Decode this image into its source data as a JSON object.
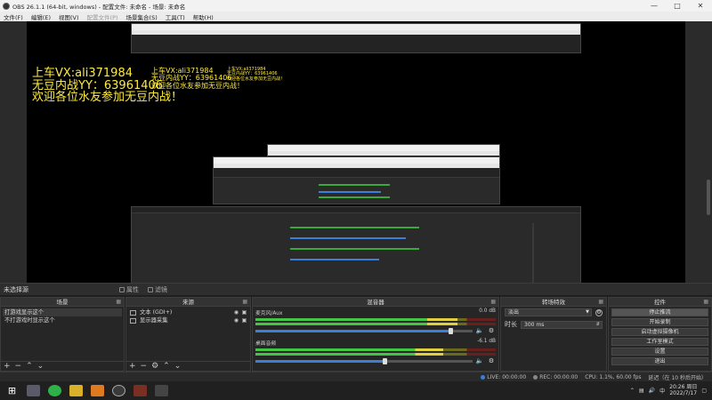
{
  "window": {
    "title": "OBS 26.1.1 (64-bit, windows) - 配置文件: 未命名 - 场景: 未命名"
  },
  "menu": {
    "items": [
      {
        "label": "文件(F)",
        "disabled": false
      },
      {
        "label": "编辑(E)",
        "disabled": false
      },
      {
        "label": "视图(V)",
        "disabled": false
      },
      {
        "label": "配置文件(P)",
        "disabled": true
      },
      {
        "label": "场景集合(S)",
        "disabled": false
      },
      {
        "label": "工具(T)",
        "disabled": false
      },
      {
        "label": "帮助(H)",
        "disabled": false
      }
    ]
  },
  "overlay": {
    "line1": "上车VX:ali371984",
    "line2": "无豆内战YY：63961406",
    "line3": "欢迎各位水友参加无豆内战！"
  },
  "tabline": {
    "no_source": "未选择源",
    "properties": "属性",
    "filters": "滤镜"
  },
  "scenes": {
    "title": "场景",
    "items": [
      "打游戏显示这个",
      "不打游戏时显示这个"
    ]
  },
  "sources": {
    "title": "来源",
    "items": [
      "文本 (GDI+)",
      "显示器采集"
    ]
  },
  "mixer": {
    "title": "混音器",
    "channels": [
      {
        "name": "麦克风/Aux",
        "db": "0.0 dB",
        "level": 0.84,
        "volume": 0.9
      },
      {
        "name": "桌面音频",
        "db": "-6.1 dB",
        "level": 0.78,
        "volume": 0.6
      }
    ]
  },
  "transitions": {
    "title": "转场特效",
    "selected": "淡出",
    "duration_label": "时长",
    "duration_value": "300 ms"
  },
  "controls": {
    "title": "控件",
    "buttons": [
      "停止推流",
      "开始录制",
      "启动虚拟摄像机",
      "工作室模式",
      "设置",
      "退出"
    ]
  },
  "status": {
    "live": "LIVE: 00:00:00",
    "rec": "REC: 00:00:00",
    "cpu": "CPU: 1.1%, 60.00 fps",
    "delay": "延迟（在 10 秒后开始）"
  },
  "taskbar": {
    "time": "20:26 周日",
    "date": "2022/7/17",
    "ime": "中",
    "apps": [
      "terminal-app",
      "wechat-app",
      "3d-app",
      "orange-app",
      "obs-app",
      "game-app",
      "pad-app"
    ]
  },
  "colors": {
    "overlay": "#ffeb3b",
    "meter_green": "#45c545",
    "accent": "#3b7fd6"
  }
}
